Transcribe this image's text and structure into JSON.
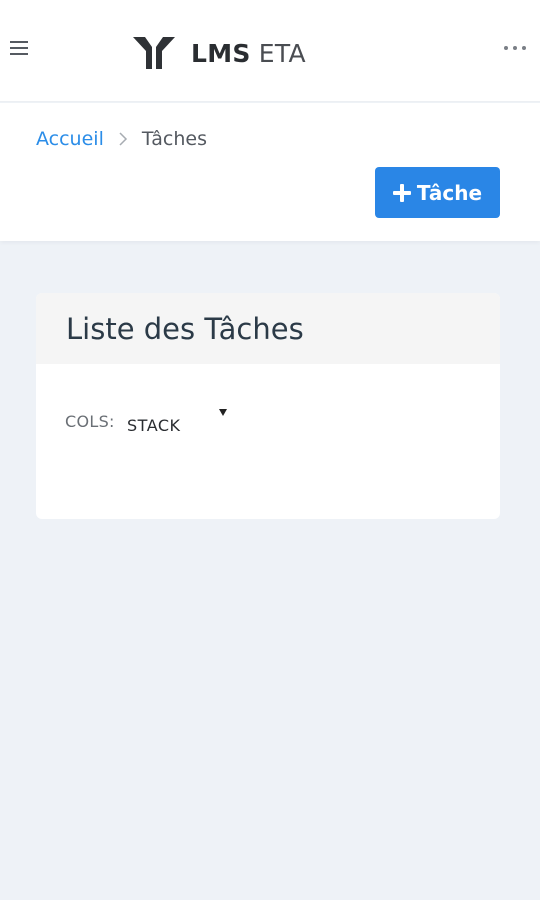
{
  "header": {
    "brand_bold": "LMS",
    "brand_light": "ETA",
    "menu_icon": "hamburger-icon",
    "more_icon": "more-horizontal-icon"
  },
  "breadcrumb": {
    "home": "Accueil",
    "separator_icon": "chevron-right-icon",
    "current": "Tâches"
  },
  "actions": {
    "add_task_label": "Tâche",
    "add_icon": "plus-icon"
  },
  "card": {
    "title": "Liste des Tâches",
    "cols_label": "COLS:",
    "cols_value": "STACK"
  },
  "colors": {
    "accent": "#2a86e6",
    "link": "#2b8de8",
    "background": "#eef2f7"
  }
}
